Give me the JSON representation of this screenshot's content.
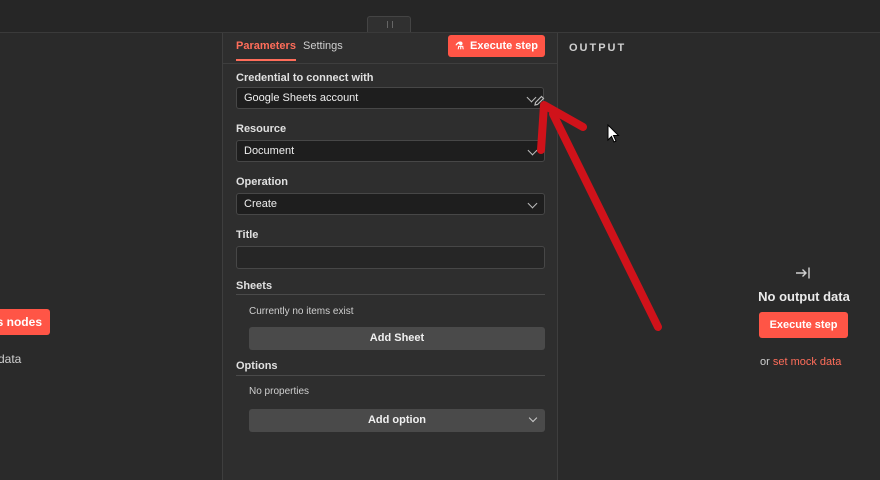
{
  "left": {
    "title_fragment": "ata",
    "button_fragment": "s nodes",
    "text_fragment": "data"
  },
  "tabs": {
    "parameters": "Parameters",
    "settings": "Settings"
  },
  "execute_step_label": "Execute step",
  "fields": {
    "credential": {
      "label": "Credential to connect with",
      "value": "Google Sheets account"
    },
    "resource": {
      "label": "Resource",
      "value": "Document"
    },
    "operation": {
      "label": "Operation",
      "value": "Create"
    },
    "title": {
      "label": "Title",
      "value": ""
    }
  },
  "sheets": {
    "label": "Sheets",
    "empty_text": "Currently no items exist",
    "add_button": "Add Sheet"
  },
  "options": {
    "label": "Options",
    "empty_text": "No properties",
    "add_button": "Add option"
  },
  "output": {
    "header": "OUTPUT",
    "no_data": "No output data",
    "execute_button": "Execute step",
    "or_text": "or",
    "mock_link": "set mock data"
  },
  "colors": {
    "accent": "#ff5546",
    "annotation_arrow": "#d0121a"
  },
  "icons": {
    "pencil": "pencil-icon",
    "flask": "flask-icon",
    "output": "arrow-into-bar-icon",
    "cursor": "mouse-cursor-icon"
  }
}
